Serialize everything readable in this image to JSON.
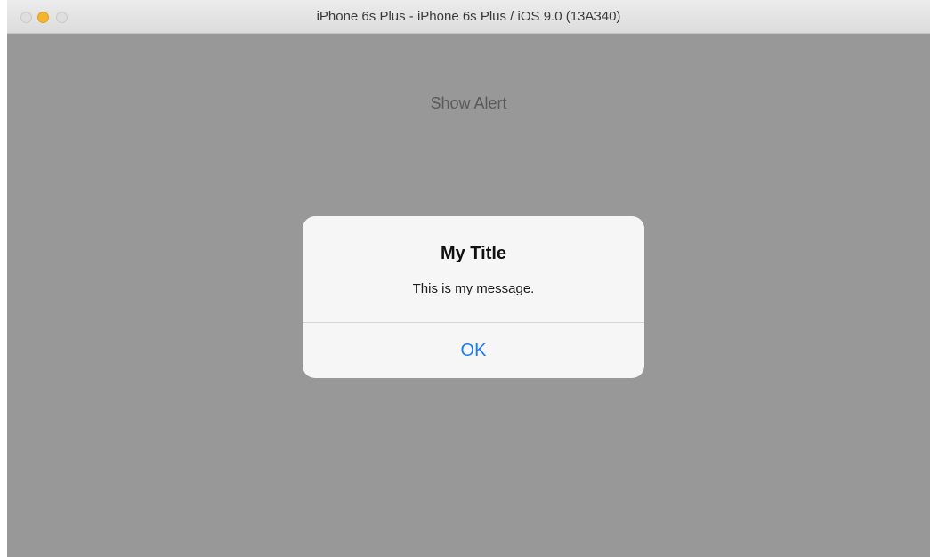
{
  "window": {
    "title": "iPhone 6s Plus - iPhone 6s Plus / iOS 9.0 (13A340)",
    "controls": [
      "close-button",
      "minimize-button",
      "zoom-button"
    ]
  },
  "app": {
    "show_alert_label": "Show Alert"
  },
  "alert": {
    "title": "My Title",
    "message": "This is my message.",
    "ok_label": "OK"
  },
  "colors": {
    "screen_dim": "#989898",
    "alert_background": "#f6f6f6",
    "ios_blue": "#1b7cf5",
    "minimize_yellow": "#f5b52e"
  }
}
